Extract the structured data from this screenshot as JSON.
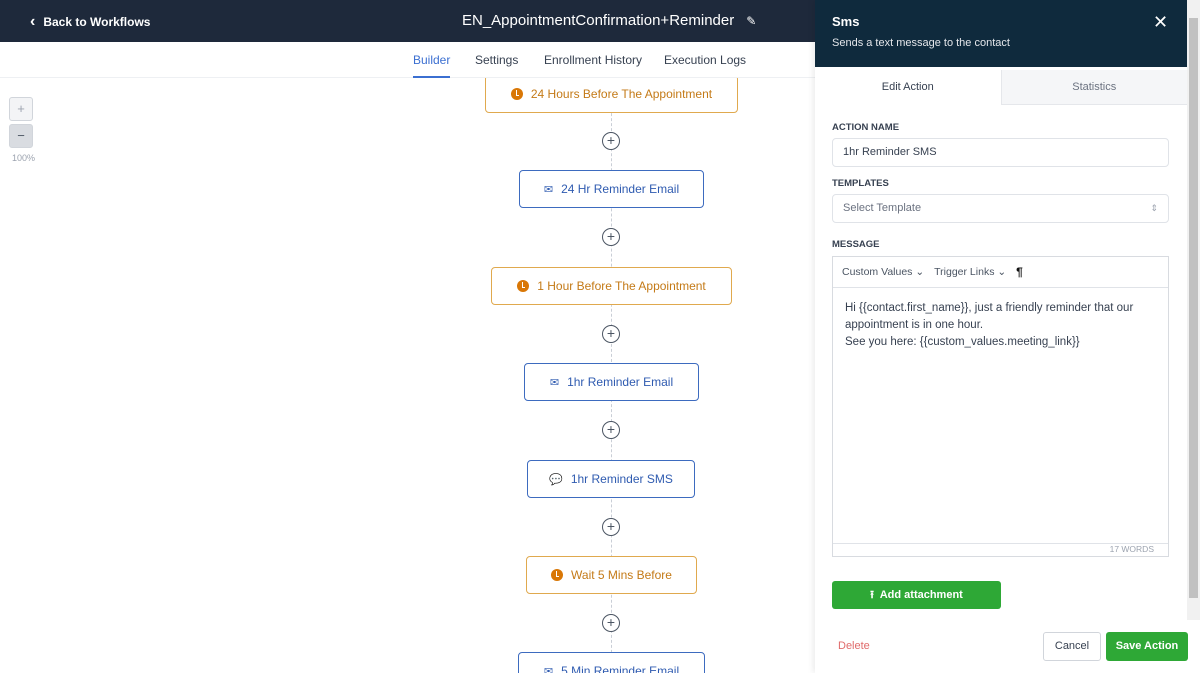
{
  "header": {
    "back_label": "Back to Workflows",
    "workflow_title": "EN_AppointmentConfirmation+Reminder"
  },
  "tabs": [
    "Builder",
    "Settings",
    "Enrollment History",
    "Execution Logs"
  ],
  "zoom": {
    "plus": "+",
    "minus": "−",
    "level": "100%"
  },
  "nodes": [
    {
      "type": "wait",
      "label": "24 Hours Before The Appointment"
    },
    {
      "type": "email",
      "label": "24 Hr Reminder Email"
    },
    {
      "type": "wait",
      "label": "1 Hour Before The Appointment"
    },
    {
      "type": "email",
      "label": "1hr Reminder Email"
    },
    {
      "type": "sms",
      "label": "1hr Reminder SMS"
    },
    {
      "type": "wait",
      "label": "Wait 5 Mins Before"
    },
    {
      "type": "email",
      "label": "5 Min Reminder Email"
    }
  ],
  "panel": {
    "title": "Sms",
    "subtitle": "Sends a text message to the contact",
    "tabs": [
      "Edit Action",
      "Statistics"
    ],
    "action_name_label": "ACTION NAME",
    "action_name_value": "1hr Reminder SMS",
    "templates_label": "TEMPLATES",
    "templates_placeholder": "Select Template",
    "message_label": "MESSAGE",
    "toolbar": {
      "custom_values": "Custom Values",
      "trigger_links": "Trigger Links",
      "paragraph": "¶"
    },
    "message_lines": [
      "Hi {{contact.first_name}}, just a friendly reminder that our appointment is in one hour.",
      "See you here: {{custom_values.meeting_link}}"
    ],
    "word_count": "17 WORDS",
    "add_attachment": "Add attachment",
    "delete": "Delete",
    "cancel": "Cancel",
    "save": "Save Action"
  },
  "colors": {
    "accent": "#3b6fd1",
    "green": "#2ea836",
    "wait": "#d97706",
    "header": "#1e293b"
  }
}
